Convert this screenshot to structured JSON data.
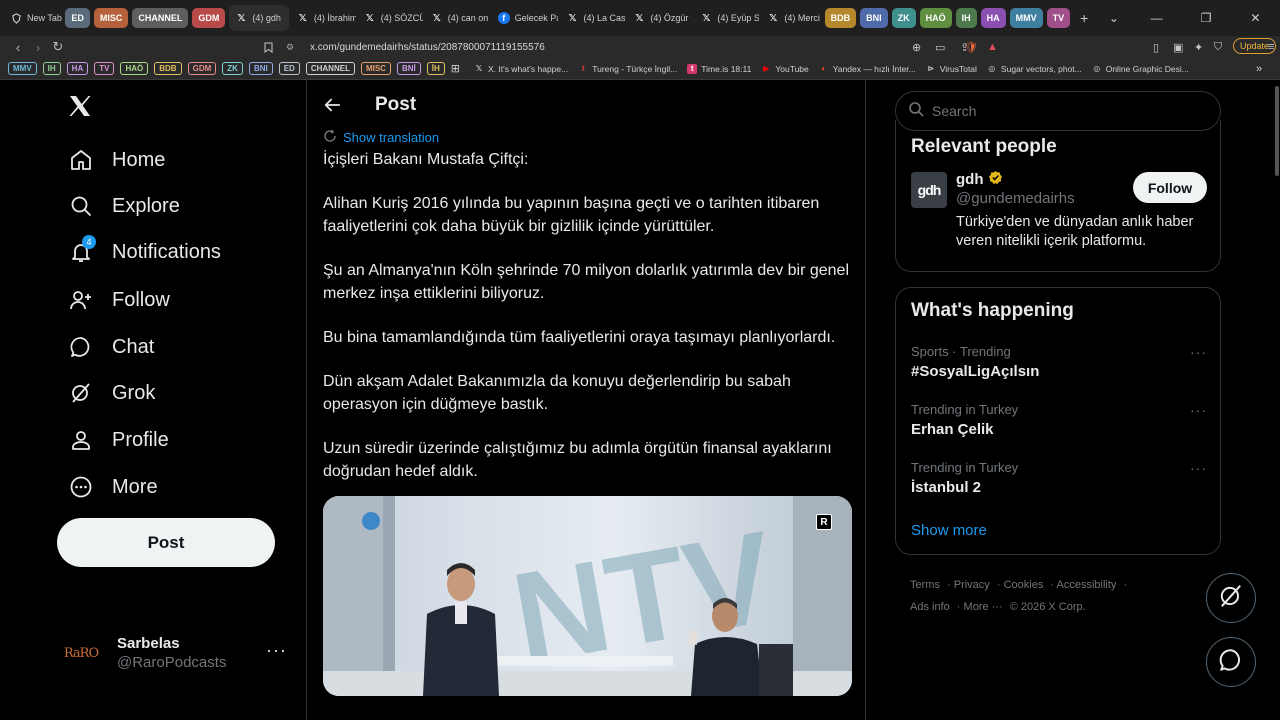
{
  "browser": {
    "tabs": [
      {
        "label": "New Tab",
        "icon": "brave-icon"
      },
      {
        "label": "(4) gdh",
        "icon": "x-icon",
        "active": true
      },
      {
        "label": "(4) İbrahim",
        "icon": "x-icon"
      },
      {
        "label": "(4) SÖZCÜ",
        "icon": "x-icon"
      },
      {
        "label": "(4) can on",
        "icon": "x-icon"
      },
      {
        "label": "Gelecek Pa",
        "icon": "facebook-icon"
      },
      {
        "label": "(4) La Casa",
        "icon": "x-icon"
      },
      {
        "label": "(4) Özgür",
        "icon": "x-icon"
      },
      {
        "label": "(4) Eyüp Sa",
        "icon": "x-icon"
      },
      {
        "label": "(4) Merci",
        "icon": "x-icon"
      }
    ],
    "tab_groups_left": [
      {
        "label": "ED",
        "color": "#5b6b7b"
      },
      {
        "label": "MISC",
        "color": "#b5613b"
      },
      {
        "label": "CHANNEL",
        "color": "#5e5e5e"
      },
      {
        "label": "GDM",
        "color": "#b84a4a"
      }
    ],
    "tab_groups_right": [
      {
        "label": "BDB",
        "color": "#b5892b"
      },
      {
        "label": "BNI",
        "color": "#4e6aa8"
      },
      {
        "label": "ZK",
        "color": "#3f8f8f"
      },
      {
        "label": "HAÖ",
        "color": "#5f8f3f"
      },
      {
        "label": "IH",
        "color": "#4c7a4c"
      },
      {
        "label": "HA",
        "color": "#8a4fb0"
      },
      {
        "label": "MMV",
        "color": "#3f7f9f"
      },
      {
        "label": "TV",
        "color": "#a04f8a"
      }
    ],
    "url": "x.com/gundemedairhs/status/2087800071119155576",
    "update_label": "Update",
    "bookmark_tags": [
      {
        "label": "MMV",
        "color": "#6fb8d8"
      },
      {
        "label": "IH",
        "color": "#8fcf8f"
      },
      {
        "label": "HA",
        "color": "#c89ae8"
      },
      {
        "label": "TV",
        "color": "#e08fd0"
      },
      {
        "label": "HAÖ",
        "color": "#a8d88a"
      },
      {
        "label": "BDB",
        "color": "#e0c060"
      },
      {
        "label": "GDM",
        "color": "#e88a8a"
      },
      {
        "label": "ZK",
        "color": "#7fd0d0"
      },
      {
        "label": "BNI",
        "color": "#8fa8e8"
      },
      {
        "label": "ED",
        "color": "#b8c4d0"
      },
      {
        "label": "CHANNEL",
        "color": "#d0d0d0"
      },
      {
        "label": "MISC",
        "color": "#e8a070"
      },
      {
        "label": "BNİ",
        "color": "#c89ae8"
      },
      {
        "label": "İH",
        "color": "#e0c060"
      }
    ],
    "bookmarks": [
      {
        "label": "X. It's what's happe...",
        "icon": "x-icon"
      },
      {
        "label": "Tureng - Türkçe İngil...",
        "icon": "tureng-icon"
      },
      {
        "label": "Time.is 18:11",
        "icon": "time-icon"
      },
      {
        "label": "YouTube",
        "icon": "youtube-icon"
      },
      {
        "label": "Yandex — hızlı İnter...",
        "icon": "yandex-icon"
      },
      {
        "label": "VirusTotal",
        "icon": "virustotal-icon"
      },
      {
        "label": "Sugar vectors, phot...",
        "icon": "globe-icon"
      },
      {
        "label": "Online Graphic Desi...",
        "icon": "globe-icon"
      }
    ]
  },
  "nav": {
    "items": [
      {
        "label": "Home",
        "icon": "home-icon"
      },
      {
        "label": "Explore",
        "icon": "search-icon"
      },
      {
        "label": "Notifications",
        "icon": "bell-icon",
        "badge": "4"
      },
      {
        "label": "Follow",
        "icon": "person-add-icon"
      },
      {
        "label": "Chat",
        "icon": "chat-icon"
      },
      {
        "label": "Grok",
        "icon": "grok-icon"
      },
      {
        "label": "Profile",
        "icon": "person-icon"
      },
      {
        "label": "More",
        "icon": "more-circle-icon"
      }
    ],
    "post_button": "Post",
    "account": {
      "name": "Sarbelas",
      "handle": "@RaroPodcasts",
      "avatar_text": "RaRO"
    }
  },
  "post": {
    "header": "Post",
    "show_translation": "Show translation",
    "paragraphs": [
      "İçişleri Bakanı Mustafa Çiftçi:",
      "Alihan Kuriş 2016 yılında bu yapının başına geçti ve o tarihten itibaren faaliyetlerini çok daha büyük bir gizlilik içinde yürüttüler.",
      "Şu an Almanya'nın Köln şehrinde 70 milyon dolarlık yatırımla dev bir genel merkez inşa ettiklerini biliyoruz.",
      "Bu bina tamamlandığında tüm faaliyetlerini oraya taşımayı planlıyorlardı.",
      "Dün akşam Adalet Bakanımızla da konuyu değerlendirip bu sabah operasyon için düğmeye bastık.",
      "Uzun süredir üzerinde çalıştığımız bu adımla örgütün finansal ayaklarını doğrudan hedef aldık."
    ],
    "media": {
      "badge": "R",
      "backdrop_text": "NTV"
    }
  },
  "sidebar": {
    "search_placeholder": "Search",
    "relevant": {
      "title": "Relevant people",
      "name": "gdh",
      "handle": "@gundemedairhs",
      "bio": "Türkiye'den ve dünyadan anlık haber veren nitelikli içerik platformu.",
      "follow_label": "Follow",
      "avatar_text": "gdh"
    },
    "happening": {
      "title": "What's happening",
      "trends": [
        {
          "meta": "Sports · Trending",
          "name": "#SosyalLigAçılsın"
        },
        {
          "meta": "Trending in Turkey",
          "name": "Erhan Çelik"
        },
        {
          "meta": "Trending in Turkey",
          "name": "İstanbul 2"
        }
      ],
      "show_more": "Show more"
    },
    "footer": [
      "Terms",
      "Privacy",
      "Cookies",
      "Accessibility",
      "Ads info",
      "More ···",
      "© 2026 X Corp."
    ]
  },
  "colors": {
    "accent": "#1d9bf0",
    "background": "#000000",
    "text": "#e7e9ea",
    "muted": "#71767b",
    "border": "#2f3336",
    "verified_gold": "#e2b719"
  }
}
